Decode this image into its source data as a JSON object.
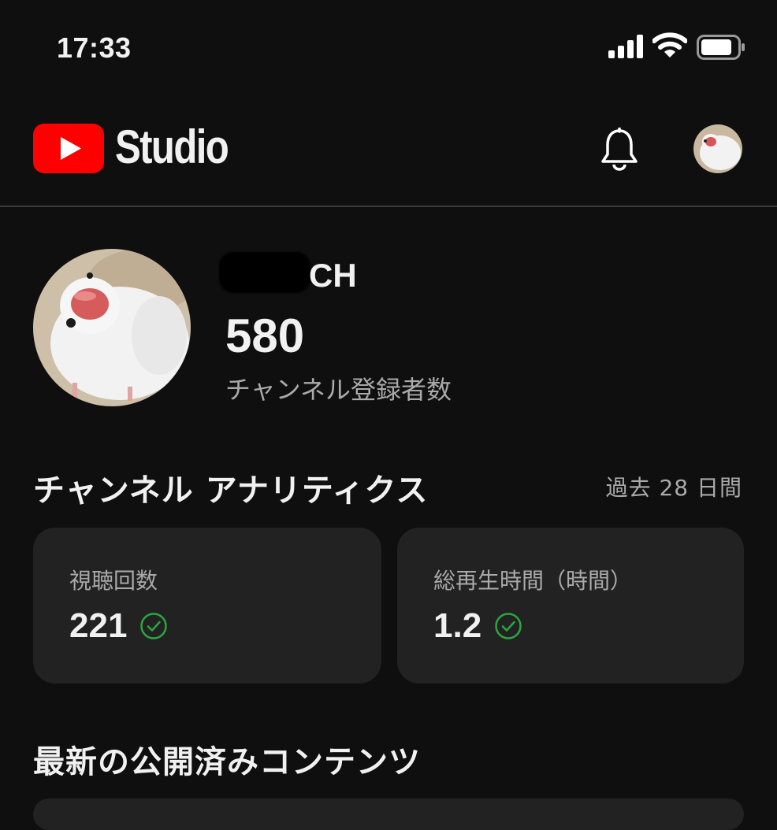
{
  "status_bar": {
    "time": "17:33",
    "icons": [
      "signal-icon",
      "wifi-icon",
      "battery-icon"
    ]
  },
  "header": {
    "app_name": "Studio",
    "logo": "youtube-play-icon",
    "notifications_icon": "bell-icon",
    "account_icon": "avatar"
  },
  "channel": {
    "name_suffix": "CH",
    "subscriber_count": "580",
    "subscriber_label": "チャンネル登録者数"
  },
  "analytics": {
    "title": "チャンネル アナリティクス",
    "period": "過去 28 日間",
    "cards": [
      {
        "label": "視聴回数",
        "value": "221",
        "icon": "check-circle-icon"
      },
      {
        "label": "総再生時間（時間）",
        "value": "1.2",
        "icon": "check-circle-icon"
      }
    ]
  },
  "latest": {
    "title": "最新の公開済みコンテンツ"
  },
  "colors": {
    "background": "#0f0f0f",
    "brand_red": "#ff0000",
    "card": "#222222",
    "check_green": "#2ba640",
    "secondary_text": "#aaaaaa"
  }
}
